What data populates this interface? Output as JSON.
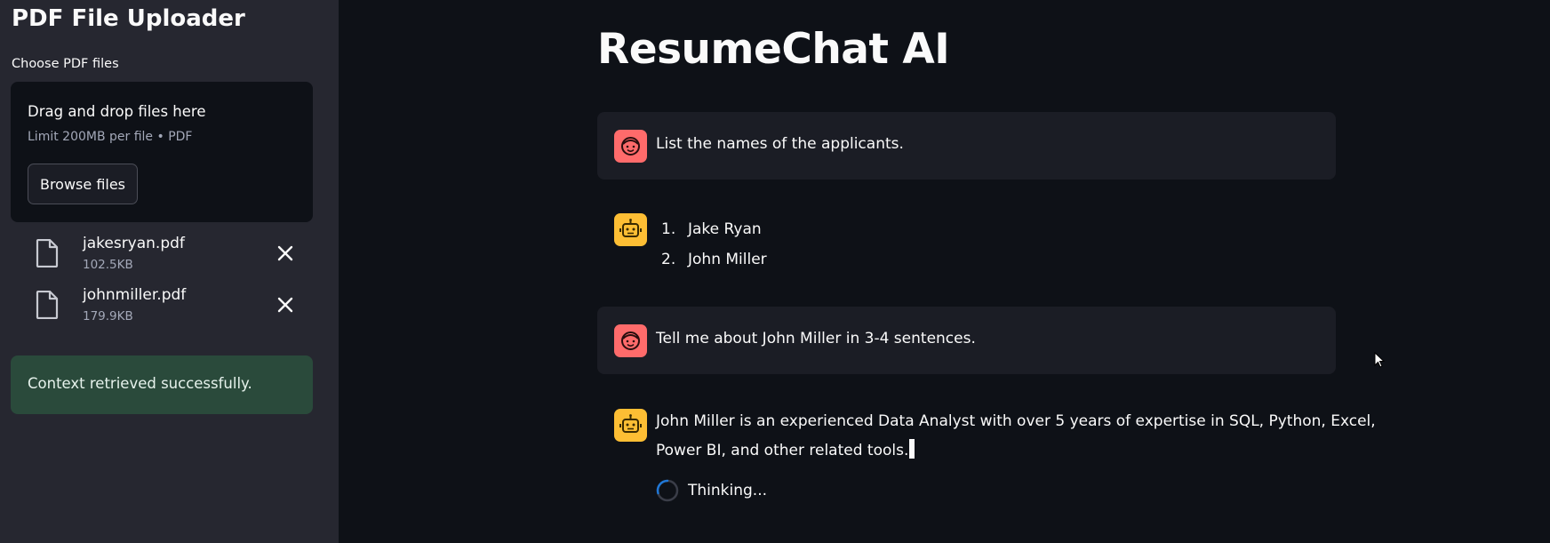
{
  "sidebar": {
    "title": "PDF File Uploader",
    "uploader_label": "Choose PDF files",
    "dropzone": {
      "title": "Drag and drop files here",
      "limit_text": "Limit 200MB per file • PDF",
      "browse_label": "Browse files"
    },
    "files": [
      {
        "name": "jakesryan.pdf",
        "size": "102.5KB",
        "icon": "file-icon"
      },
      {
        "name": "johnmiller.pdf",
        "size": "179.9KB",
        "icon": "file-icon"
      }
    ],
    "status": "Context retrieved successfully."
  },
  "main": {
    "title": "ResumeChat AI",
    "messages": [
      {
        "role": "user",
        "avatar": "user-face-icon",
        "text": "List the names of the applicants."
      },
      {
        "role": "assistant",
        "avatar": "robot-icon",
        "list": [
          "Jake Ryan",
          "John Miller"
        ]
      },
      {
        "role": "user",
        "avatar": "user-face-icon",
        "text": "Tell me about John Miller in 3-4 sentences."
      },
      {
        "role": "assistant",
        "avatar": "robot-icon",
        "lines": [
          "John Miller is an experienced Data Analyst with over 5 years of expertise in SQL, Python, Excel,",
          "Power BI, and other related tools."
        ],
        "status": "Thinking..."
      }
    ]
  },
  "colors": {
    "background": "#0e1117",
    "sidebar": "#262730",
    "user_avatar": "#ff6b6b",
    "assistant_avatar": "#fdbe34",
    "success_bg": "#2a4a3b",
    "spinner": "#1f77d6"
  }
}
